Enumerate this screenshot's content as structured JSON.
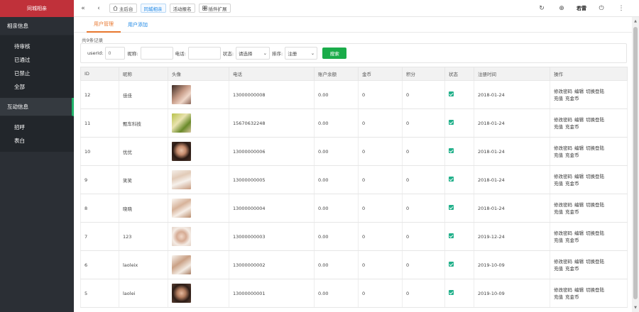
{
  "sidebar": {
    "brand": "同城相亲",
    "groups": [
      {
        "title": "相亲信息",
        "items": [
          "待审核",
          "已通过",
          "已禁止",
          "全部"
        ]
      },
      {
        "title": "互动信息",
        "items": [
          "招呼",
          "表白"
        ]
      }
    ]
  },
  "topbar": {
    "collapse_icon": "double-chevron-left-icon",
    "back_icon": "chevron-left-icon",
    "buttons": [
      {
        "icon": "home-icon",
        "label": "主后台"
      },
      {
        "icon": "",
        "label": "同城相亲"
      },
      {
        "icon": "",
        "label": "活动报名"
      },
      {
        "icon": "plugin-icon",
        "label": "插件扩展"
      }
    ],
    "user": "若雷"
  },
  "tabs": [
    "用户管理",
    "用户添加"
  ],
  "record_count": "共9条记录",
  "filter": {
    "userid_label": "userId:",
    "userid_placeholder": "0",
    "nickname_label": "昵称:",
    "phone_label": "电话:",
    "status_label": "状态:",
    "status_value": "请选择",
    "sort_label": "排序:",
    "sort_value": "注册",
    "search_label": "搜索"
  },
  "table": {
    "headers": [
      "ID",
      "昵称",
      "头像",
      "电话",
      "账户余额",
      "金币",
      "积分",
      "状态",
      "注册时间",
      "操作"
    ],
    "ops": {
      "line1": [
        "修改密码",
        "编辑",
        "切换登陆"
      ],
      "line2": [
        "充值",
        "充金币"
      ]
    },
    "rows": [
      {
        "id": "12",
        "nickname": "佳佳",
        "phone": "13000000008",
        "balance": "0.00",
        "coins": "0",
        "points": "0",
        "date": "2018-01-24"
      },
      {
        "id": "11",
        "nickname": "甄车科技",
        "phone": "15670632248",
        "balance": "0.00",
        "coins": "0",
        "points": "0",
        "date": "2018-01-24"
      },
      {
        "id": "10",
        "nickname": "优优",
        "phone": "13000000006",
        "balance": "0.00",
        "coins": "0",
        "points": "0",
        "date": "2018-01-24"
      },
      {
        "id": "9",
        "nickname": "笑笑",
        "phone": "13000000005",
        "balance": "0.00",
        "coins": "0",
        "points": "0",
        "date": "2018-01-24"
      },
      {
        "id": "8",
        "nickname": "晓晓",
        "phone": "13000000004",
        "balance": "0.00",
        "coins": "0",
        "points": "0",
        "date": "2018-01-24"
      },
      {
        "id": "7",
        "nickname": "123",
        "phone": "13000000003",
        "balance": "0.00",
        "coins": "0",
        "points": "0",
        "date": "2019-12-24"
      },
      {
        "id": "6",
        "nickname": "laoleix",
        "phone": "13000000002",
        "balance": "0.00",
        "coins": "0",
        "points": "0",
        "date": "2019-10-09"
      },
      {
        "id": "5",
        "nickname": "laolei",
        "phone": "13000000001",
        "balance": "0.00",
        "coins": "0",
        "points": "0",
        "date": "2019-10-09"
      }
    ]
  },
  "colors": {
    "brand": "#c0313a",
    "sidebar": "#2b2f35",
    "accent_green": "#1aac4a",
    "tab_active": "#e8772e",
    "link_blue": "#1e88e5"
  }
}
